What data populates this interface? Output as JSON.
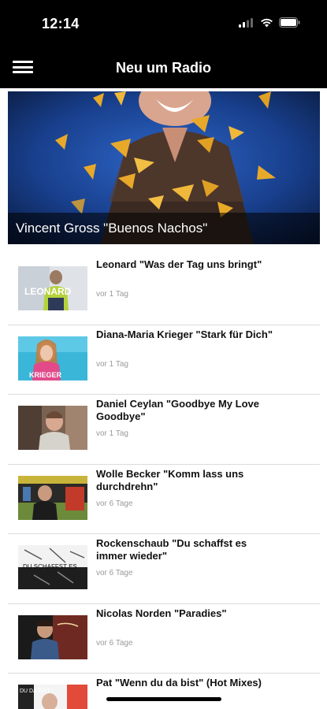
{
  "status": {
    "time": "12:14"
  },
  "header": {
    "title": "Neu um Radio"
  },
  "hero": {
    "title": "Vincent Gross \"Buenos Nachos\""
  },
  "items": [
    {
      "title": "Leonard \"Was der Tag uns bringt\"",
      "time": "vor 1 Tag",
      "thumb_text": "LEONARD"
    },
    {
      "title": "Diana-Maria Krieger \"Stark für Dich\"",
      "time": "vor 1 Tag",
      "thumb_text": "KRIEGER"
    },
    {
      "title": "Daniel Ceylan \"Goodbye My Love Goodbye\"",
      "time": "vor 1 Tag"
    },
    {
      "title": "Wolle Becker \"Komm lass uns durchdrehn\"",
      "time": "vor 6 Tage"
    },
    {
      "title": "Rockenschaub \"Du schaffst es immer wieder\"",
      "time": "vor 6 Tage",
      "thumb_text": "DU SCHAFFST ES"
    },
    {
      "title": "Nicolas Norden \"Paradies\"",
      "time": "vor 6 Tage"
    },
    {
      "title": "Pat \"Wenn du da bist\" (Hot Mixes)",
      "time": "",
      "thumb_text": "DU DA BIST"
    }
  ],
  "colors": {
    "bar_bg": "#000000",
    "hero_bg": "#163a82",
    "accent_gold": "#e8a92a"
  },
  "icons": [
    "menu-icon",
    "signal-icon",
    "wifi-icon",
    "battery-icon"
  ]
}
